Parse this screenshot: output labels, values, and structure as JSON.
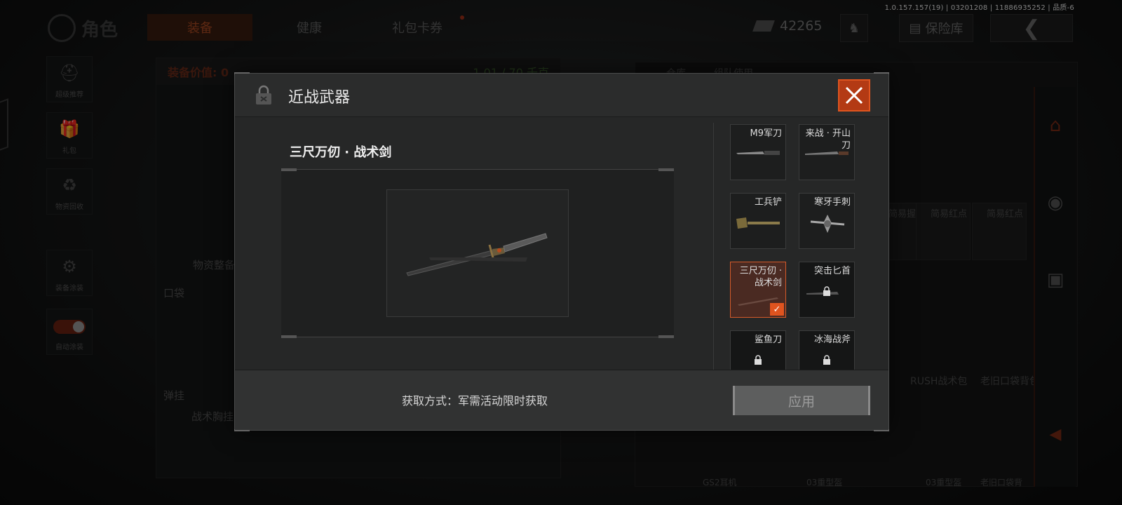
{
  "version_info": "1.0.157.157(19) | 03201208 | 11886935252 | 品质-6",
  "header": {
    "logo_text": "角色",
    "tabs": [
      {
        "label": "装备",
        "active": true
      },
      {
        "label": "健康",
        "active": false
      },
      {
        "label": "礼包卡券",
        "active": false
      }
    ],
    "currency_value": "42265",
    "vault_label": "保险库",
    "back_icon": "chevron-left-icon"
  },
  "left_sidebar": [
    {
      "label": "超级推荐",
      "icon": "helmet-icon"
    },
    {
      "label": "礼包",
      "icon": "gift-icon"
    },
    {
      "label": "物资回收",
      "icon": "recycle-icon"
    },
    {
      "label": "装备涂装",
      "icon": "paint-icon"
    },
    {
      "label": "自动涂装",
      "icon": "toggle-icon"
    }
  ],
  "loadout_panel": {
    "value_label": "装备价值: 0",
    "weight_label": "1.01 / 70 千克",
    "supplies_label": "物资整备",
    "pocket_label": "口袋",
    "sling_label": "弹挂",
    "vest_label": "战术胸挂"
  },
  "storage_panel": {
    "tabs": [
      "仓库",
      "组队使用"
    ],
    "items": [
      "简易握把",
      "简易红点",
      "简易红点"
    ],
    "bags": [
      "RUSH战术包",
      "老旧口袋背包"
    ],
    "bottom_labels": [
      "GS2耳机",
      "03重型盔",
      "03重型盔",
      "老旧口袋背"
    ]
  },
  "modal": {
    "title": "近战武器",
    "weapon_name": "三尺万仞 · 战术剑",
    "source_text": "获取方式：军需活动限时获取",
    "apply_label": "应用",
    "accent_color": "#e0541f",
    "weapons": [
      {
        "name": "M9军刀",
        "locked": false,
        "selected": false
      },
      {
        "name": "来战 · 开山刀",
        "locked": false,
        "selected": false
      },
      {
        "name": "工兵铲",
        "locked": false,
        "selected": false
      },
      {
        "name": "寒牙手刺",
        "locked": false,
        "selected": false
      },
      {
        "name": "三尺万仞 · 战术剑",
        "locked": false,
        "selected": true
      },
      {
        "name": "突击匕首",
        "locked": true,
        "selected": false
      },
      {
        "name": "鲨鱼刀",
        "locked": true,
        "selected": false
      },
      {
        "name": "冰海战斧",
        "locked": true,
        "selected": false
      }
    ]
  }
}
